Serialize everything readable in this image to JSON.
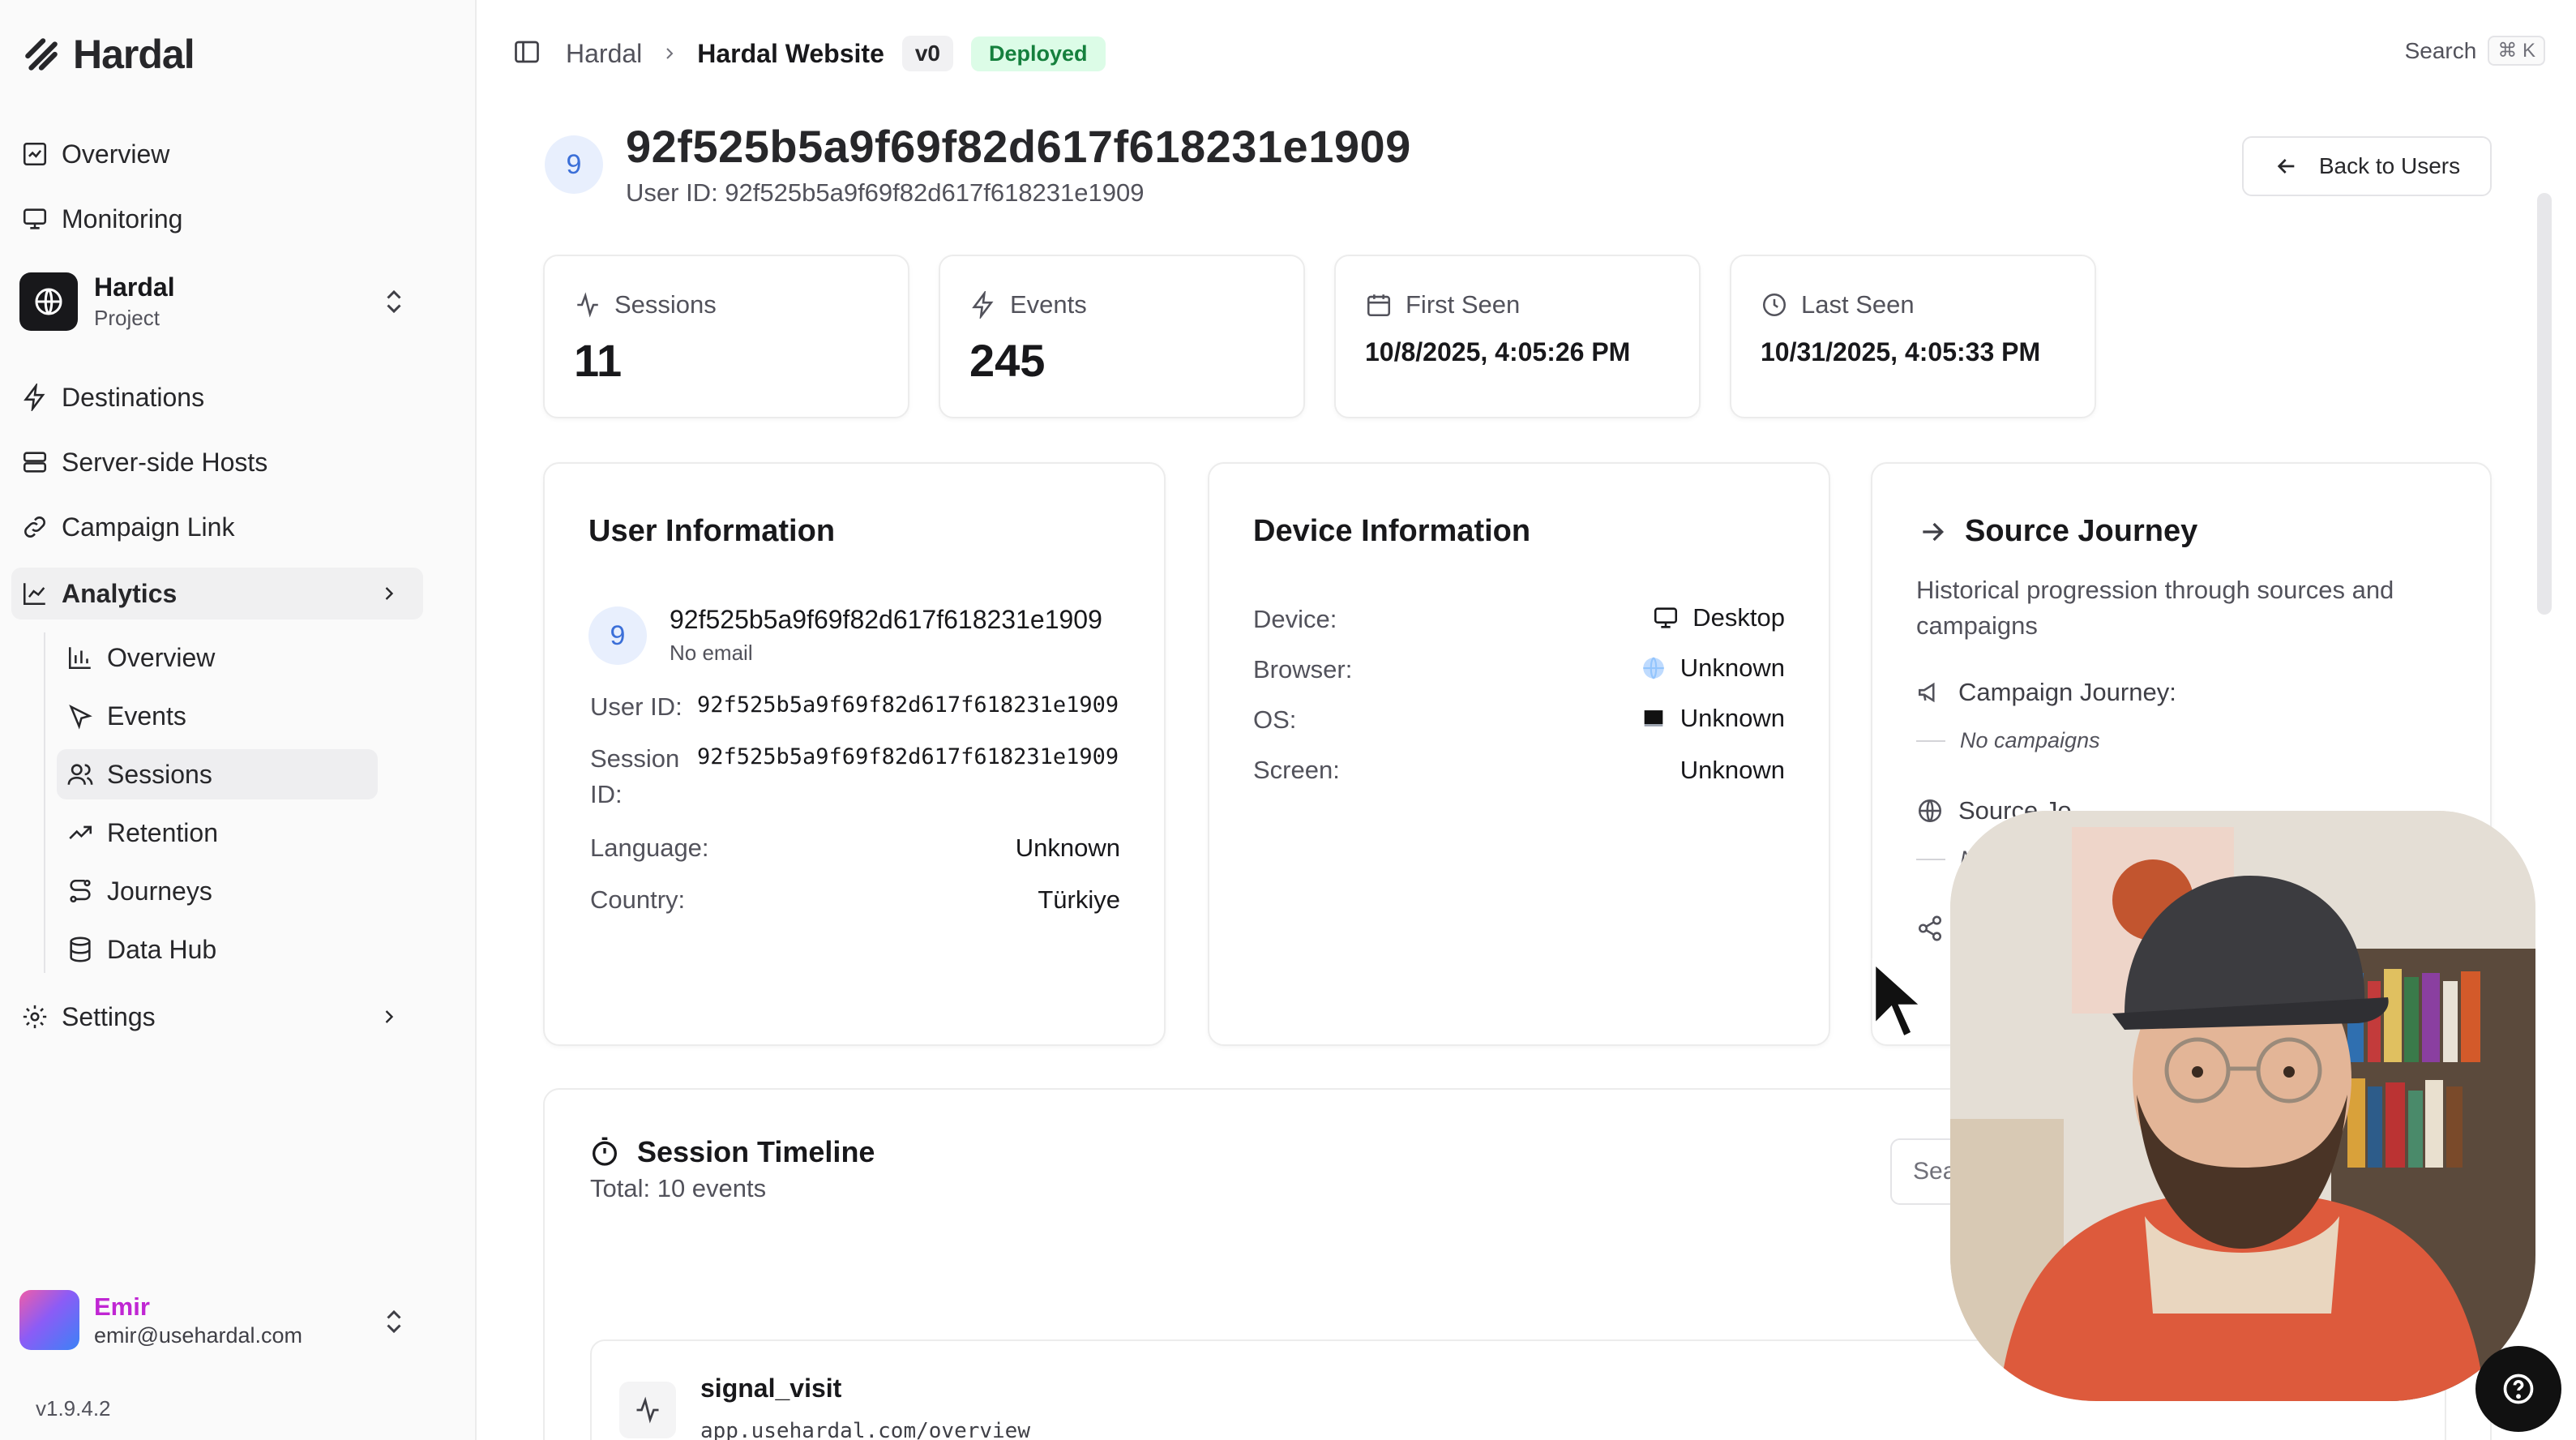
{
  "brand": {
    "name": "Hardal"
  },
  "sidebar": {
    "top_items": [
      {
        "label": "Overview",
        "icon": "overview-icon"
      },
      {
        "label": "Monitoring",
        "icon": "monitor-icon"
      }
    ],
    "project": {
      "name": "Hardal",
      "subtitle": "Project"
    },
    "items": [
      {
        "label": "Destinations",
        "icon": "lightning-icon"
      },
      {
        "label": "Server-side Hosts",
        "icon": "server-icon"
      },
      {
        "label": "Campaign Link",
        "icon": "link-icon"
      },
      {
        "label": "Analytics",
        "icon": "chart-line-icon"
      }
    ],
    "analytics_sub": [
      {
        "label": "Overview",
        "icon": "bar-chart-icon"
      },
      {
        "label": "Events",
        "icon": "pointer-icon"
      },
      {
        "label": "Sessions",
        "icon": "users-icon"
      },
      {
        "label": "Retention",
        "icon": "trend-up-icon"
      },
      {
        "label": "Journeys",
        "icon": "route-icon"
      },
      {
        "label": "Data Hub",
        "icon": "database-icon"
      }
    ],
    "settings": {
      "label": "Settings",
      "icon": "gear-icon"
    },
    "user": {
      "name": "Emir",
      "email": "emir@usehardal.com"
    },
    "version": "v1.9.4.2"
  },
  "header": {
    "breadcrumb_root": "Hardal",
    "breadcrumb_current": "Hardal Website",
    "version_badge": "v0",
    "status_badge": "Deployed",
    "search_label": "Search",
    "search_shortcut": "⌘ K"
  },
  "user_header": {
    "avatar_letter": "9",
    "title": "92f525b5a9f69f82d617f618231e1909",
    "subtitle": "User ID: 92f525b5a9f69f82d617f618231e1909",
    "back_label": "Back to Users"
  },
  "stats": {
    "sessions": {
      "label": "Sessions",
      "value": "11"
    },
    "events": {
      "label": "Events",
      "value": "245"
    },
    "first_seen": {
      "label": "First Seen",
      "value": "10/8/2025, 4:05:26 PM"
    },
    "last_seen": {
      "label": "Last Seen",
      "value": "10/31/2025, 4:05:33 PM"
    }
  },
  "user_info": {
    "title": "User Information",
    "avatar_letter": "9",
    "name": "92f525b5a9f69f82d617f618231e1909",
    "email": "No email",
    "user_id_label": "User ID:",
    "user_id": "92f525b5a9f69f82d617f618231e1909",
    "session_label_1": "Session",
    "session_label_2": "ID:",
    "session_id": "92f525b5a9f69f82d617f618231e1909",
    "language_label": "Language:",
    "language": "Unknown",
    "country_label": "Country:",
    "country": "Türkiye"
  },
  "device_info": {
    "title": "Device Information",
    "rows": [
      {
        "label": "Device:",
        "value": "Desktop"
      },
      {
        "label": "Browser:",
        "value": "Unknown"
      },
      {
        "label": "OS:",
        "value": "Unknown"
      },
      {
        "label": "Screen:",
        "value": "Unknown"
      }
    ]
  },
  "source_journey": {
    "title": "Source Journey",
    "description": "Historical progression through sources and campaigns",
    "campaign_label": "Campaign Journey:",
    "campaign_empty": "No campaigns",
    "source_label": "Source Jo",
    "source_empty": "N"
  },
  "timeline": {
    "title": "Session Timeline",
    "subtitle": "Total: 10 events",
    "search_placeholder": "Sea",
    "events": [
      {
        "name": "signal_visit",
        "url": "app.usehardal.com/overview"
      }
    ]
  }
}
